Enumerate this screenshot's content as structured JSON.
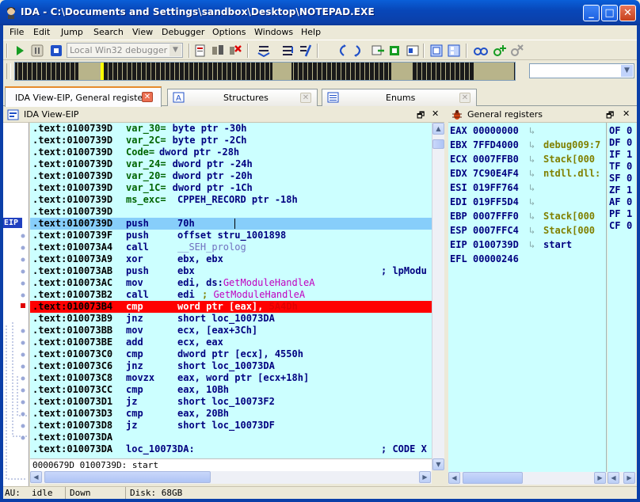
{
  "window": {
    "title": "IDA - C:\\Documents and Settings\\sandbox\\Desktop\\NOTEPAD.EXE"
  },
  "menu": [
    "File",
    "Edit",
    "Jump",
    "Search",
    "View",
    "Debugger",
    "Options",
    "Windows",
    "Help"
  ],
  "toolbar": {
    "debugger_select": "Local Win32 debugger"
  },
  "tabs": [
    {
      "label": "IDA View-EIP, General registers",
      "active": true
    },
    {
      "label": "Structures",
      "active": false
    },
    {
      "label": "Enums",
      "active": false
    }
  ],
  "ida_view": {
    "title": "IDA View-EIP",
    "eip_marker": "EIP",
    "status": "0000679D 0100739D: start",
    "lines": [
      {
        "addr": ".text:0100739D",
        "op": "var_30=",
        "arg": "byte ptr -30h",
        "style": "var"
      },
      {
        "addr": ".text:0100739D",
        "op": "var_2C=",
        "arg": "byte ptr -2Ch",
        "style": "var"
      },
      {
        "addr": ".text:0100739D",
        "op": "Code=",
        "arg": "dword ptr -28h",
        "style": "var"
      },
      {
        "addr": ".text:0100739D",
        "op": "var_24=",
        "arg": "dword ptr -24h",
        "style": "var"
      },
      {
        "addr": ".text:0100739D",
        "op": "var_20=",
        "arg": "dword ptr -20h",
        "style": "var"
      },
      {
        "addr": ".text:0100739D",
        "op": "var_1C=",
        "arg": "dword ptr -1Ch",
        "style": "var"
      },
      {
        "addr": ".text:0100739D",
        "op": "ms_exc=",
        "arg": "CPPEH_RECORD ptr -18h",
        "style": "var"
      },
      {
        "addr": ".text:0100739D",
        "op": "",
        "arg": "",
        "style": "plain"
      },
      {
        "addr": ".text:0100739D",
        "op": "push",
        "arg": "70h",
        "style": "eip"
      },
      {
        "addr": ".text:0100739F",
        "op": "push",
        "arg": "offset stru_1001898",
        "style": "plain"
      },
      {
        "addr": ".text:010073A4",
        "op": "call",
        "arg": "__SEH_prolog",
        "style": "callfn"
      },
      {
        "addr": ".text:010073A9",
        "op": "xor",
        "arg": "ebx, ebx",
        "style": "plain"
      },
      {
        "addr": ".text:010073AB",
        "op": "push",
        "arg": "ebx",
        "comment": "; lpModu",
        "style": "plain"
      },
      {
        "addr": ".text:010073AC",
        "op": "mov",
        "arg": "edi, ds:",
        "import": "GetModuleHandleA",
        "style": "import"
      },
      {
        "addr": ".text:010073B2",
        "op": "call",
        "arg": "edi",
        "comment": "; GetModuleHandleA",
        "style": "importc"
      },
      {
        "addr": ".text:010073B4",
        "op": "cmp",
        "arg": "word ptr [eax],",
        "hidden": "5A4Dh",
        "style": "bp"
      },
      {
        "addr": ".text:010073B9",
        "op": "jnz",
        "arg": "short loc_10073DA",
        "style": "plain"
      },
      {
        "addr": ".text:010073BB",
        "op": "mov",
        "arg": "ecx, [eax+3Ch]",
        "style": "plain"
      },
      {
        "addr": ".text:010073BE",
        "op": "add",
        "arg": "ecx, eax",
        "style": "plain"
      },
      {
        "addr": ".text:010073C0",
        "op": "cmp",
        "arg": "dword ptr [ecx], 4550h",
        "style": "plain"
      },
      {
        "addr": ".text:010073C6",
        "op": "jnz",
        "arg": "short loc_10073DA",
        "style": "plain"
      },
      {
        "addr": ".text:010073C8",
        "op": "movzx",
        "arg": "eax, word ptr [ecx+18h]",
        "style": "plain"
      },
      {
        "addr": ".text:010073CC",
        "op": "cmp",
        "arg": "eax, 10Bh",
        "style": "plain"
      },
      {
        "addr": ".text:010073D1",
        "op": "jz",
        "arg": "short loc_10073F2",
        "style": "plain"
      },
      {
        "addr": ".text:010073D3",
        "op": "cmp",
        "arg": "eax, 20Bh",
        "style": "plain"
      },
      {
        "addr": ".text:010073D8",
        "op": "jz",
        "arg": "short loc_10073DF",
        "style": "plain"
      },
      {
        "addr": ".text:010073DA",
        "op": "",
        "arg": "",
        "style": "plain"
      },
      {
        "addr": ".text:010073DA",
        "op": "loc_10073DA:",
        "arg": "",
        "comment": "; CODE X",
        "style": "label"
      }
    ]
  },
  "registers": {
    "title": "General registers",
    "rows": [
      {
        "name": "EAX",
        "value": "00000000",
        "arrow": true,
        "ref": ""
      },
      {
        "name": "EBX",
        "value": "7FFD4000",
        "arrow": true,
        "ref": "debug009:7"
      },
      {
        "name": "ECX",
        "value": "0007FFB0",
        "arrow": true,
        "ref": "Stack[000"
      },
      {
        "name": "EDX",
        "value": "7C90E4F4",
        "arrow": true,
        "ref": "ntdll.dll:"
      },
      {
        "name": "ESI",
        "value": "019FF764",
        "arrow": true,
        "ref": ""
      },
      {
        "name": "EDI",
        "value": "019FF5D4",
        "arrow": true,
        "ref": ""
      },
      {
        "name": "EBP",
        "value": "0007FFF0",
        "arrow": true,
        "ref": "Stack[000"
      },
      {
        "name": "ESP",
        "value": "0007FFC4",
        "arrow": true,
        "ref": "Stack[000"
      },
      {
        "name": "EIP",
        "value": "0100739D",
        "arrow": true,
        "ref": "start"
      },
      {
        "name": "EFL",
        "value": "00000246",
        "arrow": false,
        "ref": ""
      }
    ],
    "flags": [
      {
        "name": "OF",
        "value": "0"
      },
      {
        "name": "DF",
        "value": "0"
      },
      {
        "name": "IF",
        "value": "1"
      },
      {
        "name": "TF",
        "value": "0"
      },
      {
        "name": "SF",
        "value": "0"
      },
      {
        "name": "ZF",
        "value": "1"
      },
      {
        "name": "AF",
        "value": "0"
      },
      {
        "name": "PF",
        "value": "1"
      },
      {
        "name": "CF",
        "value": "0"
      }
    ]
  },
  "statusbar": {
    "au_label": "AU:",
    "au_value": "idle",
    "direction": "Down",
    "disk": "Disk: 68GB"
  }
}
